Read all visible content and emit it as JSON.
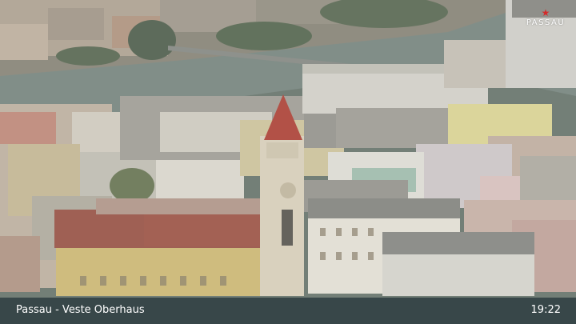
{
  "logo": {
    "text": "PASSAU",
    "mark": "★"
  },
  "caption": {
    "location": "Passau - Veste Oberhaus",
    "time": "19:22"
  },
  "colors": {
    "bar": "#2c3a3f",
    "tower_roof": "#b5463c",
    "river": "#7e8b86",
    "logo_accent": "#d42a2a"
  }
}
